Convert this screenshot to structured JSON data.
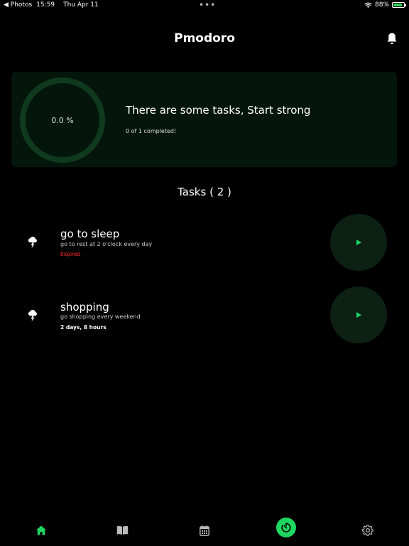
{
  "status_bar": {
    "back_app": "◀ Photos",
    "time": "15:59",
    "date": "Thu Apr 11",
    "battery": "88%",
    "battery_level": 0.88
  },
  "header": {
    "title": "Pmodoro"
  },
  "summary": {
    "progress_percent": "0.0 %",
    "progress_fraction": 0,
    "heading": "There are some tasks, Start strong",
    "completed_text": "0 of 1 completed!"
  },
  "tasks_heading": "Tasks ( 2 )",
  "tasks": [
    {
      "title": "go to sleep",
      "description": "go to rest at 2 o'clock every day",
      "status": "Expired"
    },
    {
      "title": "shopping",
      "description": "go shopping every weekend",
      "status": "2 days, 8 hours"
    }
  ],
  "nav": {
    "items": [
      "home-icon",
      "book-icon",
      "calendar-icon",
      "timer-icon",
      "settings-icon"
    ]
  },
  "colors": {
    "accent": "#1ed760",
    "card_bg": "#04160c",
    "ring": "#0f3a1e",
    "expired": "#ff2a2a"
  }
}
